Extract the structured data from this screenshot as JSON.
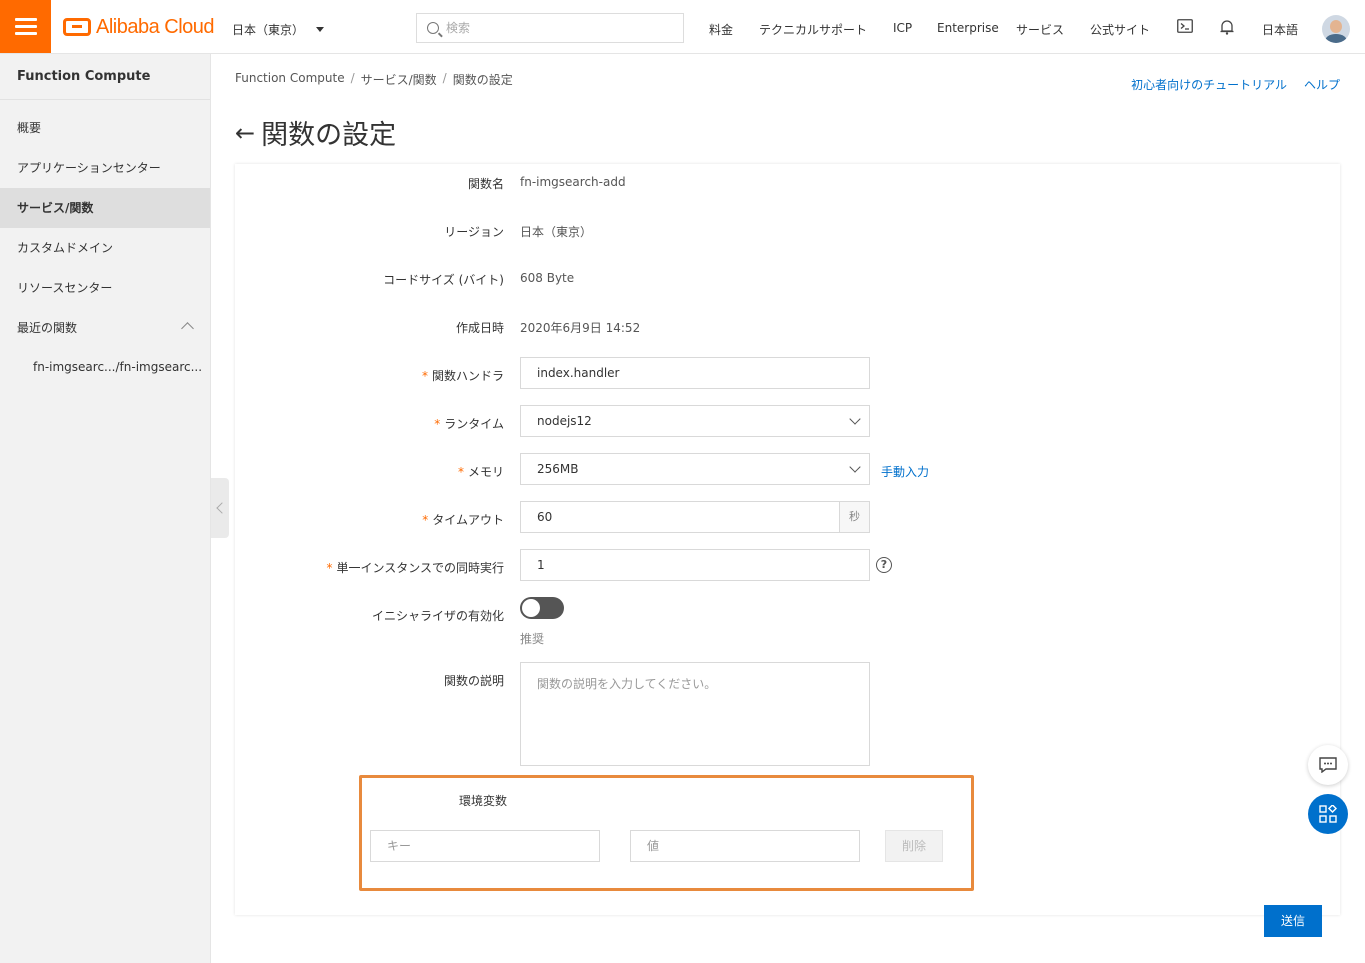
{
  "topbar": {
    "brand": "Alibaba Cloud",
    "region": "日本（東京）",
    "search_placeholder": "検索",
    "nav": [
      "料金",
      "テクニカルサポート",
      "ICP",
      "Enterprise",
      "サービス",
      "公式サイト"
    ],
    "language": "日本語"
  },
  "sidebar": {
    "title": "Function Compute",
    "items": [
      "概要",
      "アプリケーションセンター",
      "サービス/関数",
      "カスタムドメイン",
      "リソースセンター",
      "最近の関数"
    ],
    "active_index": 2,
    "recent": "fn-imgsearc.../fn-imgsearc..."
  },
  "breadcrumb": [
    "Function Compute",
    "サービス/関数",
    "関数の設定"
  ],
  "help": {
    "tutorial": "初心者向けのチュートリアル",
    "help": "ヘルプ"
  },
  "page_title": "関数の設定",
  "form": {
    "function_name_label": "関数名",
    "function_name": "fn-imgsearch-add",
    "region_label": "リージョン",
    "region": "日本（東京）",
    "code_size_label": "コードサイズ (バイト)",
    "code_size": "608 Byte",
    "created_label": "作成日時",
    "created": "2020年6月9日 14:52",
    "handler_label": "関数ハンドラ",
    "handler": "index.handler",
    "runtime_label": "ランタイム",
    "runtime": "nodejs12",
    "memory_label": "メモリ",
    "memory": "256MB",
    "manual_input": "手動入力",
    "timeout_label": "タイムアウト",
    "timeout": "60",
    "timeout_unit": "秒",
    "concurrency_label": "単一インスタンスでの同時実行",
    "concurrency": "1",
    "initializer_label": "イニシャライザの有効化",
    "initializer_enabled": false,
    "initializer_hint": "推奨",
    "description_label": "関数の説明",
    "description_placeholder": "関数の説明を入力してください。",
    "env_label": "環境変数",
    "env_key_placeholder": "キー",
    "env_value_placeholder": "値",
    "env_delete": "削除",
    "required_mark": "*"
  },
  "submit": "送信",
  "colors": {
    "brand": "#ff6a00",
    "primary": "#0070cc",
    "highlight": "#e88a3d"
  }
}
